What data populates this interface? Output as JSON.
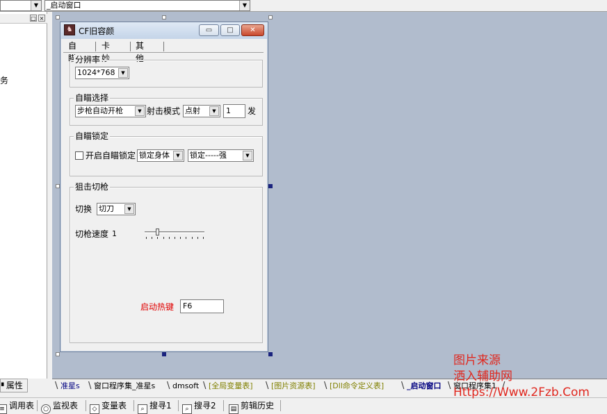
{
  "top_combos": {
    "left_value": "",
    "object_value": "_启动窗口"
  },
  "left_panel": {
    "partial_text": "务",
    "pin_icon": "□",
    "close_icon": "×",
    "bottom_tab": "属性"
  },
  "form": {
    "title": "CF旧容颜",
    "tabs": [
      "自瞄",
      "卡妙",
      "其他"
    ],
    "groups": {
      "resolution": {
        "label": "分辨率",
        "value": "1024*768"
      },
      "aim_select": {
        "label": "自瞄选择",
        "weapon_value": "步枪自动开枪",
        "fire_mode_label": "射击模式",
        "fire_mode_value": "点射",
        "count_value": "1",
        "count_unit": "发"
      },
      "aim_lock": {
        "label": "自瞄锁定",
        "enable_label": "开启自瞄锁定",
        "target_value": "锁定身体",
        "strength_value": "锁定-----强"
      },
      "sniper_switch": {
        "label": "狙击切枪",
        "switch_label": "切换",
        "switch_value": "切刀",
        "speed_label": "切枪速度",
        "speed_value": "1",
        "speed_level": 0.2
      }
    },
    "hotkey_label": "启动热键",
    "hotkey_value": "F6",
    "colors": {
      "hotkey_label": "#e00000",
      "title_gradient_top": "#dfe9f5"
    }
  },
  "bottom_tabs": [
    {
      "label": "准星s",
      "color": "#000080"
    },
    {
      "label": "窗口程序集_准星s",
      "color": "#000000"
    },
    {
      "label": "dmsoft",
      "color": "#000000"
    },
    {
      "label": "[全局变量表]",
      "color": "#808000"
    },
    {
      "label": "[图片资源表]",
      "color": "#808000"
    },
    {
      "label": "[Dll命令定义表]",
      "color": "#808000"
    },
    {
      "label": "_启动窗口",
      "color": "#000080"
    },
    {
      "label": "窗口程序集1",
      "color": "#000000"
    }
  ],
  "toolbar": [
    "调用表",
    "监视表",
    "变量表",
    "搜寻1",
    "搜寻2",
    "剪辑历史"
  ],
  "watermark": {
    "line1": "图片来源",
    "line2": "洒入辅助网",
    "line3": "Https://Www.2Fzb.Com"
  }
}
